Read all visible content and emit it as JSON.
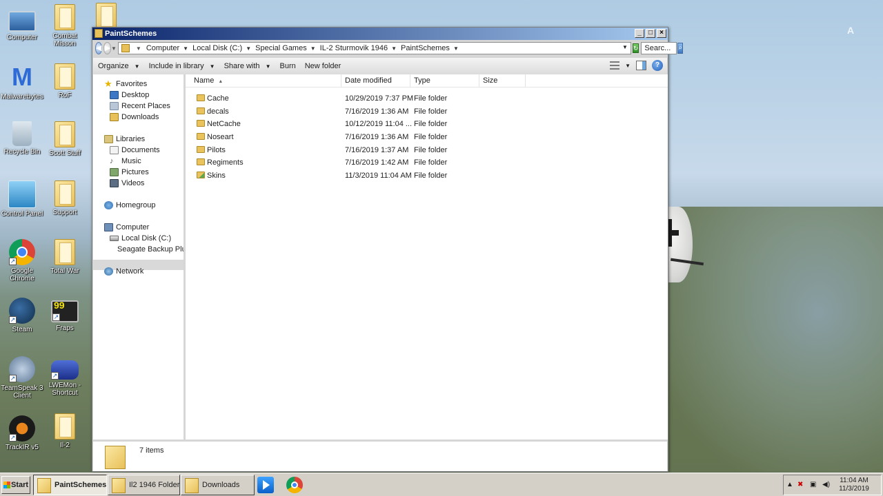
{
  "desktop": {
    "watermark": "A",
    "icons": [
      {
        "label": "Computer",
        "icon": "computer-icon"
      },
      {
        "label": "Combat Misson",
        "icon": "folder-icon"
      },
      {
        "label": "",
        "icon": "folder-icon"
      },
      {
        "label": "Malwarebytes",
        "icon": "malwarebytes-icon"
      },
      {
        "label": "RoF",
        "icon": "folder-icon"
      },
      {
        "label": "Recycle Bin",
        "icon": "recycle-bin-icon"
      },
      {
        "label": "Scott Stuff",
        "icon": "folder-icon"
      },
      {
        "label": "Control Panel",
        "icon": "control-panel-icon"
      },
      {
        "label": "Support",
        "icon": "folder-icon"
      },
      {
        "label": "Google Chrome",
        "icon": "chrome-icon"
      },
      {
        "label": "Total War",
        "icon": "folder-icon"
      },
      {
        "label": "Steam",
        "icon": "steam-icon"
      },
      {
        "label": "Fraps",
        "icon": "fraps-icon"
      },
      {
        "label": "TeamSpeak 3 Client",
        "icon": "teamspeak-icon"
      },
      {
        "label": "LWEMon - Shortcut",
        "icon": "gamepad-icon"
      },
      {
        "label": "TrackIR v5",
        "icon": "trackir-icon"
      },
      {
        "label": "Il-2",
        "icon": "folder-icon"
      }
    ]
  },
  "window": {
    "title": "PaintSchemes",
    "breadcrumbs": [
      "Computer",
      "Local Disk (C:)",
      "Special Games",
      "IL-2 Sturmovik 1946",
      "PaintSchemes"
    ],
    "search_placeholder": "Searc...",
    "toolbar": {
      "organize": "Organize",
      "include_in_library": "Include in library",
      "share_with": "Share with",
      "burn": "Burn",
      "new_folder": "New folder"
    },
    "nav": {
      "favorites": "Favorites",
      "desktop": "Desktop",
      "recent_places": "Recent Places",
      "downloads": "Downloads",
      "libraries": "Libraries",
      "documents": "Documents",
      "music": "Music",
      "pictures": "Pictures",
      "videos": "Videos",
      "homegroup": "Homegroup",
      "computer": "Computer",
      "local_disk": "Local Disk (C:)",
      "seagate": "Seagate Backup Plus D",
      "network": "Network"
    },
    "columns": [
      "Name",
      "Date modified",
      "Type",
      "Size"
    ],
    "files": [
      {
        "name": "Cache",
        "date": "10/29/2019 7:37 PM",
        "type": "File folder"
      },
      {
        "name": "decals",
        "date": "7/16/2019 1:36 AM",
        "type": "File folder"
      },
      {
        "name": "NetCache",
        "date": "10/12/2019 11:04 ...",
        "type": "File folder"
      },
      {
        "name": "Noseart",
        "date": "7/16/2019 1:36 AM",
        "type": "File folder"
      },
      {
        "name": "Pilots",
        "date": "7/16/2019 1:37 AM",
        "type": "File folder"
      },
      {
        "name": "Regiments",
        "date": "7/16/2019 1:42 AM",
        "type": "File folder"
      },
      {
        "name": "Skins",
        "date": "11/3/2019 11:04 AM",
        "type": "File folder"
      }
    ],
    "status": "7 items"
  },
  "taskbar": {
    "start": "Start",
    "tasks": [
      "PaintSchemes",
      "Il2 1946 Folder",
      "Downloads"
    ],
    "time": "11:04 AM",
    "date": "11/3/2019"
  }
}
